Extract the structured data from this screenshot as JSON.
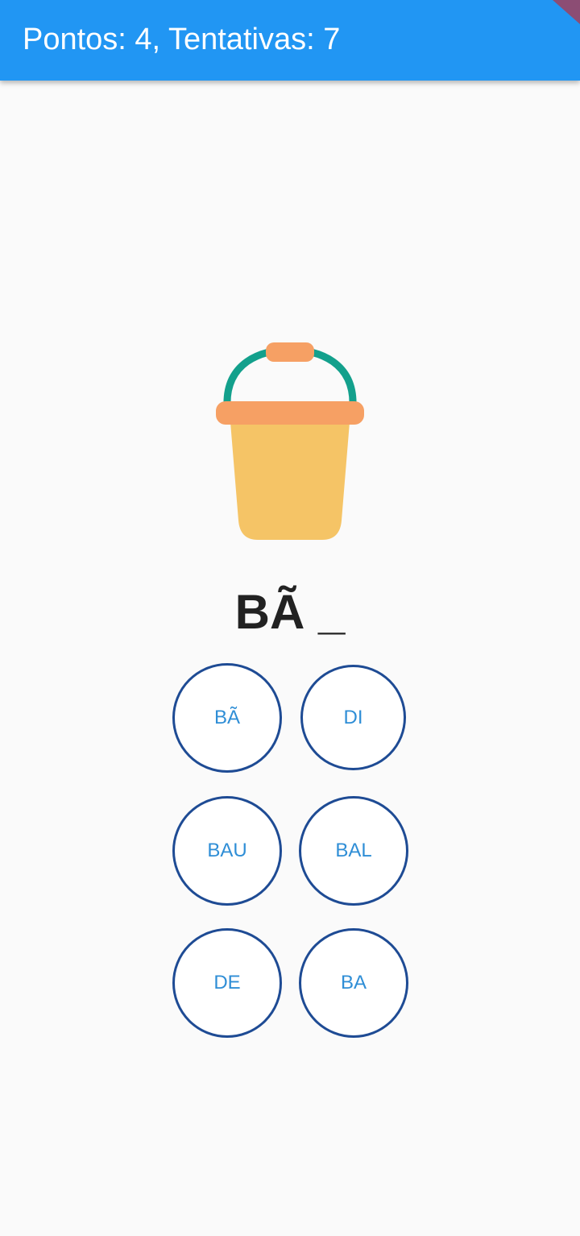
{
  "appbar": {
    "title": "Pontos: 4, Tentativas: 7",
    "color": "#2196f3"
  },
  "illustration": {
    "icon": "bucket-icon"
  },
  "prompt": {
    "word": "BÃ _"
  },
  "options": [
    {
      "label": "BÃ"
    },
    {
      "label": "DI"
    },
    {
      "label": "BAU"
    },
    {
      "label": "BAL"
    },
    {
      "label": "DE"
    },
    {
      "label": "BA"
    }
  ],
  "colors": {
    "option_border": "#1e4b94",
    "option_text": "#2f8ed6",
    "bucket_body": "#f5c466",
    "bucket_rim": "#f6a064",
    "bucket_handle": "#13a08c"
  }
}
